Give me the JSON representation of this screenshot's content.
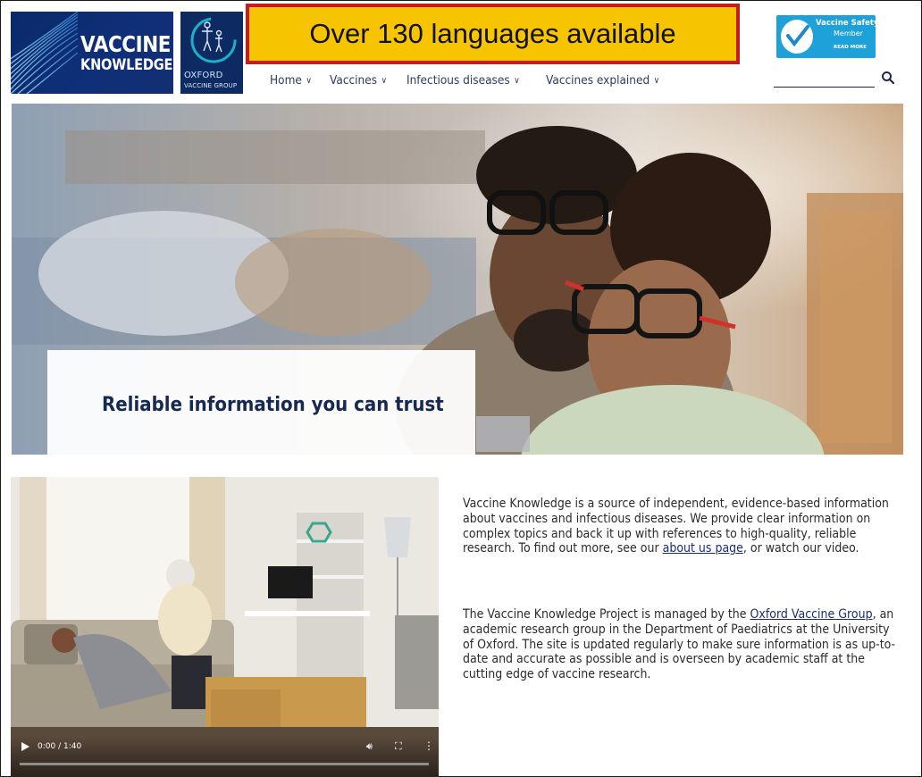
{
  "header": {
    "logo_vaccine": {
      "line1": "VACCINE",
      "line2": "KNOWLEDGE"
    },
    "logo_ovg": {
      "line1": "OXFORD",
      "line2": "VACCINE GROUP"
    },
    "banner_text": "Over 130 languages available",
    "badge": {
      "line1": "Vaccine Safety Net",
      "line2": "Member",
      "line3": "READ MORE"
    },
    "nav": [
      {
        "label": "Home"
      },
      {
        "label": "Vaccines"
      },
      {
        "label": "Infectious diseases"
      },
      {
        "label": "Vaccines explained"
      }
    ],
    "search": {
      "placeholder": ""
    }
  },
  "hero": {
    "caption": "Reliable information you can trust"
  },
  "video": {
    "time": "0:00 / 1:40",
    "progress": 0
  },
  "intro": {
    "p1_before": "Vaccine Knowledge is a source of independent, evidence-based information about vaccines and infectious diseases. We provide clear information on complex topics and back it up with references to high-quality, reliable research. To find out more, see our ",
    "p1_link": "about us page",
    "p1_after": ", or watch our video.",
    "p2_before": "The Vaccine Knowledge Project is managed by the ",
    "p2_link": "Oxford Vaccine Group",
    "p2_after": ", an academic research group in the Department of Paediatrics at the University of Oxford. The site is updated regularly to make sure information is as up-to-date and accurate as possible and is overseen by academic staff at the cutting edge of vaccine research."
  },
  "colors": {
    "navy": "#17294f",
    "banner_yellow": "#f6c400",
    "banner_border": "#c51c1c",
    "badge_blue": "#1ea1d9"
  }
}
